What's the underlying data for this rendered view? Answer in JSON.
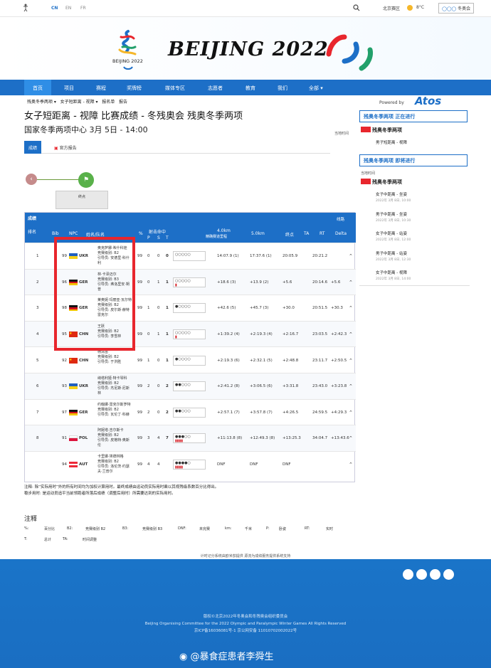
{
  "topbar": {
    "langs": [
      "CN",
      "EN",
      "FR"
    ],
    "location": "北京赛区",
    "temp": "8°C",
    "logo": "冬奥会"
  },
  "banner": {
    "title": "BEIJING 2022",
    "emblem_text": "BEIJING 2022"
  },
  "nav": [
    "首页",
    "项目",
    "赛程",
    "奖牌榜",
    "媒体专区",
    "志愿者",
    "教育",
    "我们",
    "全部"
  ],
  "breadcrumb": {
    "a": "残奥冬季两项",
    "b": "女子短距离 - 视障",
    "c": "报名单",
    "d": "报告"
  },
  "page_title": "女子短距离 - 视障 比赛成绩 - 冬残奥会 残奥冬季两项",
  "venue_line": "国家冬季两项中心 3月 5日 - 14:00",
  "local_time": "当地时间",
  "tabs": [
    "成绩",
    "官方报告"
  ],
  "flow": {
    "label": "终点"
  },
  "table": {
    "section": "成绩",
    "legend": "线路",
    "headers": {
      "rank": "排名",
      "bib": "Bib",
      "npc": "NPC",
      "name": "姓名/队名",
      "pct": "%",
      "shoot": "射击命中",
      "p": "P",
      "s": "S",
      "t": "T",
      "km4": "4.0km",
      "km4b": "精确赛道里程",
      "km5": "5.0km",
      "finish": "终点",
      "ta": "TA",
      "rt": "RT",
      "delta": "Delta"
    },
    "rows": [
      {
        "rank": "1",
        "bib": "99",
        "npc": "UKR",
        "name": "奥克萨娜·希什科娃",
        "cls": "竞赛级别: B2",
        "guide": "引导员: 安德里·科什",
        "guide2": "利",
        "pct": "99",
        "p": "0",
        "s": "0",
        "t": "0",
        "km4": "14:07.9 (1)",
        "km5": "17:37.6 (1)",
        "fin": "20:05.9",
        "rt": "20:21.2",
        "delta": ""
      },
      {
        "rank": "2",
        "bib": "96",
        "npc": "GER",
        "name": "林·卡泽迈尔",
        "cls": "竞赛级别: B3",
        "guide": "引导员: 弗洛里安·朔",
        "guide2": "普",
        "pct": "99",
        "p": "0",
        "s": "1",
        "t": "1",
        "km4": "+18.6 (3)",
        "km5": "+13.9 (2)",
        "fin": "+5.6",
        "rt": "20:14.6",
        "delta": "+5.6"
      },
      {
        "rank": "3",
        "bib": "98",
        "npc": "GER",
        "name": "莱奥妮·玛丽亚·瓦尔特",
        "cls": "竞赛级别: B2",
        "guide": "引导员: 皮尔斯·赫特",
        "guide2": "雷克尔",
        "pct": "99",
        "p": "1",
        "s": "0",
        "t": "1",
        "km4": "+42.6 (5)",
        "km5": "+45.7 (3)",
        "fin": "+30.0",
        "rt": "20:51.5",
        "delta": "+30.3"
      },
      {
        "rank": "4",
        "bib": "95",
        "npc": "CHN",
        "name": "王跃",
        "cls": "竞赛级别: B2",
        "guide": "引导员: 李雪林",
        "guide2": "",
        "pct": "99",
        "p": "0",
        "s": "1",
        "t": "1",
        "km4": "+1:39.2 (4)",
        "km5": "+2:19.3 (4)",
        "fin": "+2:16.7",
        "rt": "23:03.5",
        "delta": "+2:42.3"
      },
      {
        "rank": "5",
        "bib": "92",
        "npc": "CHN",
        "name": "杨清苗",
        "cls": "竞赛级别: B2",
        "guide": "引导员: 于洪胜",
        "guide2": "",
        "pct": "99",
        "p": "1",
        "s": "0",
        "t": "1",
        "km4": "+2:19.3 (6)",
        "km5": "+2:32.1 (5)",
        "fin": "+2:48.8",
        "rt": "23:11.7",
        "delta": "+2:50.5"
      },
      {
        "rank": "6",
        "bib": "93",
        "npc": "UKR",
        "name": "纳塔利娅·特卡琴科",
        "cls": "竞赛级别: B2",
        "guide": "引导员: 杰尼斯·尼斯",
        "guide2": "林",
        "pct": "99",
        "p": "2",
        "s": "0",
        "t": "2",
        "km4": "+2:41.2 (8)",
        "km5": "+3:06.5 (6)",
        "fin": "+3:31.8",
        "rt": "23:43.0",
        "delta": "+3:23.8"
      },
      {
        "rank": "7",
        "bib": "97",
        "npc": "GER",
        "name": "约翰娜·雷克尔斯罗特",
        "cls": "竞赛级别: B2",
        "guide": "引导员: 瓦伦丁·科赫",
        "guide2": "",
        "pct": "99",
        "p": "2",
        "s": "0",
        "t": "2",
        "km4": "+2:57.1 (7)",
        "km5": "+3:57.8 (7)",
        "fin": "+4:26.5",
        "rt": "24:59.5",
        "delta": "+4:29.3"
      },
      {
        "rank": "8",
        "bib": "91",
        "npc": "POL",
        "name": "阿妮塔·吉尔斯卡",
        "cls": "竞赛级别: B2",
        "guide": "引导员: 皮格特·奥斯",
        "guide2": "伦",
        "pct": "99",
        "p": "3",
        "s": "4",
        "t": "7",
        "km4": "+11:13.8 (8)",
        "km5": "+12:49.3 (8)",
        "fin": "+13:25.3",
        "rt": "34:04.7",
        "delta": "+13:43.6"
      },
      {
        "rank": "",
        "bib": "94",
        "npc": "AUT",
        "name": "卡里娜·埃德林格",
        "cls": "竞赛级别: B2",
        "guide": "引导员: 洛伦茨·约瑟",
        "guide2": "夫·兰普尔",
        "pct": "99",
        "p": "4",
        "s": "4",
        "t": "",
        "km4": "DNF",
        "km5": "DNF",
        "fin": "DNF",
        "rt": "",
        "delta": ""
      }
    ]
  },
  "notes": {
    "line1": "注释: 除“实际用时”外的所有时间均为加权计算用时。最终成绩由运动员实际用时乘以其视残级系数百分比得出。",
    "line2": "稳步用时: 是运动员追平当前领跑者所落后成绩（调整后用时）所需要达到的实际用时。"
  },
  "annot": {
    "title": "注释",
    "items": [
      [
        "%:",
        "百分比"
      ],
      [
        "B2:",
        "竞赛级别 B2"
      ],
      [
        "B3:",
        "竞赛级别 B3"
      ],
      [
        "DNF:",
        "未完赛"
      ],
      [
        "km:",
        "千米"
      ],
      [
        "P:",
        "卧姿"
      ],
      [
        "RT:",
        "实时"
      ],
      [
        "T:",
        "总计"
      ],
      [
        "TA:",
        "时间调整"
      ]
    ]
  },
  "provider": "计时记分系统由欧米茄提供 源流为成绩服务提供系统支持",
  "sidebar": {
    "powered": "Powered by",
    "atos": "Atos",
    "now_title": "残奥冬季两项 正在进行",
    "now_sport": "残奥冬季两项",
    "now_event": "男子短距离 - 视障",
    "next_title": "残奥冬季两项 即将进行",
    "local": "当地时间",
    "next_sport": "残奥冬季两项",
    "events": [
      [
        "女子中距离 - 坐姿",
        "2022年 3月 8日, 10:00"
      ],
      [
        "男子中距离 - 坐姿",
        "2022年 3月 8日, 10:30"
      ],
      [
        "女子中距离 - 站姿",
        "2022年 3月 8日, 12:00"
      ],
      [
        "男子中距离 - 站姿",
        "2022年 3月 8日, 12:30"
      ],
      [
        "女子中距离 - 视障",
        "2022年 3月 8日, 14:00"
      ]
    ]
  },
  "footer": {
    "l1": "版权©北京2022年冬奥会和冬残奥会组织委员会",
    "l2": "Beijing Organising Committee for the 2022 Olympic and Paralympic Winter Games All Rights Reserved",
    "l3": "京ICP备16036081号-1   京公网安备 11010702002022号"
  },
  "watermark": "@暴食症患者李舜生"
}
